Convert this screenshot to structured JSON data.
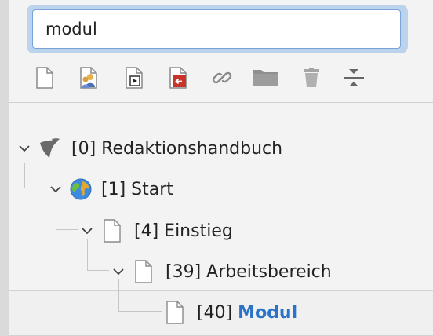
{
  "search": {
    "value": "modul"
  },
  "toolbar": {
    "buttons": [
      {
        "icon": "new-page-icon"
      },
      {
        "icon": "users-page-icon"
      },
      {
        "icon": "move-page-icon"
      },
      {
        "icon": "page-back-icon"
      },
      {
        "icon": "link-icon"
      },
      {
        "icon": "folder-icon"
      },
      {
        "icon": "trash-icon"
      },
      {
        "icon": "collapse-icon"
      }
    ]
  },
  "tree": {
    "nodes": [
      {
        "id": "[0]",
        "title": "Redaktionshandbuch",
        "icon": "typo3-logo-icon"
      },
      {
        "id": "[1]",
        "title": "Start",
        "icon": "globe-icon"
      },
      {
        "id": "[4]",
        "title": "Einstieg",
        "icon": "page-icon"
      },
      {
        "id": "[39]",
        "title": "Arbeitsbereich",
        "icon": "page-icon"
      },
      {
        "id": "[40]",
        "title": "Modul",
        "icon": "page-icon",
        "highlight": "Modul"
      }
    ]
  },
  "colors": {
    "highlight": "#2a73c9",
    "focus_ring": "#bcd3ee"
  }
}
